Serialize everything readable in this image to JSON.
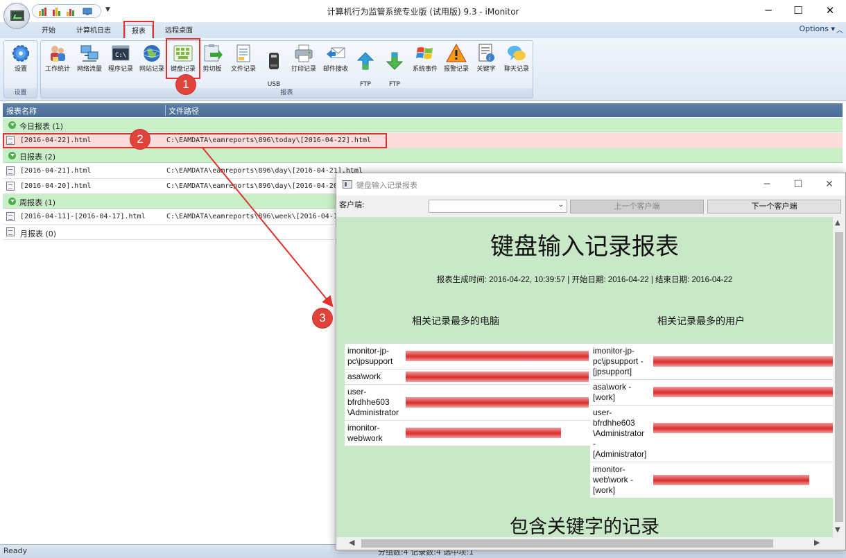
{
  "window": {
    "title": "计算机行为监管系统专业版 (试用版) 9.3 - iMonitor"
  },
  "ribbon": {
    "tabs": [
      {
        "label": "开始"
      },
      {
        "label": "计算机日志"
      },
      {
        "label": "报表"
      },
      {
        "label": "远程桌面"
      }
    ],
    "options_label": "Options",
    "groups": [
      {
        "label": "设置",
        "buttons": [
          {
            "label": "设置",
            "icon": "gear-icon"
          }
        ]
      },
      {
        "label": "报表",
        "buttons": [
          {
            "label": "工作统计",
            "icon": "users-icon"
          },
          {
            "label": "网络流量",
            "icon": "network-icon"
          },
          {
            "label": "程序记录",
            "icon": "terminal-icon"
          },
          {
            "label": "网站记录",
            "icon": "globe-icon"
          },
          {
            "label": "键盘记录",
            "icon": "keyboard-icon"
          },
          {
            "label": "剪切板",
            "icon": "clipboard-icon"
          },
          {
            "label": "文件记录",
            "icon": "file-icon"
          },
          {
            "label": "USB\n设备",
            "icon": "usb-icon"
          },
          {
            "label": "打印记录",
            "icon": "printer-icon"
          },
          {
            "label": "邮件接收",
            "icon": "mail-icon"
          },
          {
            "label": "FTP\n上传",
            "icon": "upload-icon"
          },
          {
            "label": "FTP\n下载",
            "icon": "download-icon"
          },
          {
            "label": "系统事件",
            "icon": "windows-icon"
          },
          {
            "label": "报警记录",
            "icon": "warning-icon"
          },
          {
            "label": "关键字",
            "icon": "document-icon"
          },
          {
            "label": "聊天记录",
            "icon": "chat-icon"
          }
        ]
      }
    ]
  },
  "annotations": [
    "1",
    "2",
    "3"
  ],
  "report_list": {
    "columns": [
      "报表名称",
      "文件路径"
    ],
    "groups": [
      {
        "label": "今日报表 (1)",
        "rows": [
          {
            "name": "[2016-04-22].html",
            "path": "C:\\EAMDATA\\eamreports\\896\\today\\[2016-04-22].html"
          }
        ]
      },
      {
        "label": "日报表 (2)",
        "rows": [
          {
            "name": "[2016-04-21].html",
            "path": "C:\\EAMDATA\\eamreports\\896\\day\\[2016-04-21].html"
          },
          {
            "name": "[2016-04-20].html",
            "path": "C:\\EAMDATA\\eamreports\\896\\day\\[2016-04-20].html"
          }
        ]
      },
      {
        "label": "周报表 (1)",
        "rows": [
          {
            "name": "[2016-04-11]-[2016-04-17].html",
            "path": "C:\\EAMDATA\\eamreports\\896\\week\\[2016-04-11]-[2016-04-17].html"
          }
        ]
      },
      {
        "label": "月报表 (0)",
        "rows": []
      }
    ]
  },
  "status": {
    "text": "Ready",
    "hidden_text": "分组数:4 记录数:4 选中项:1"
  },
  "popup": {
    "title": "键盘输入记录报表",
    "client_label": "客户端:",
    "client_value": "",
    "prev_button": "上一个客户端",
    "next_button": "下一个客户端",
    "report": {
      "title": "键盘输入记录报表",
      "meta": "报表生成时间: 2016-04-22, 10:39:57 | 开始日期: 2016-04-22 | 结束日期: 2016-04-22",
      "left_section": {
        "title": "相关记录最多的电脑",
        "rows": [
          {
            "name": "imonitor-jp-\npc\\jpsupport",
            "value": 1.0
          },
          {
            "name": "asa\\work",
            "value": 1.0
          },
          {
            "name": "user-\nbfrdhhe603\n\\Administrator",
            "value": 1.0
          },
          {
            "name": "imonitor-\nweb\\work",
            "value": 0.85
          }
        ]
      },
      "right_section": {
        "title": "相关记录最多的用户",
        "rows": [
          {
            "name": "imonitor-jp-\npc\\jpsupport -\n[jpsupport]",
            "value": 1.0
          },
          {
            "name": "asa\\work -\n[work]",
            "value": 1.0
          },
          {
            "name": "user-\nbfrdhhe603\n\\Administrator\n-\n[Administrator]",
            "value": 1.0
          },
          {
            "name": "imonitor-\nweb\\work -\n[work]",
            "value": 0.87
          }
        ]
      },
      "keyword_title": "包含关键字的记录"
    }
  },
  "colors": {
    "accent": "#e0322d",
    "group_green": "#c9efc9",
    "report_bg": "#c8e8c8",
    "bar_red": "#d92c2c"
  }
}
